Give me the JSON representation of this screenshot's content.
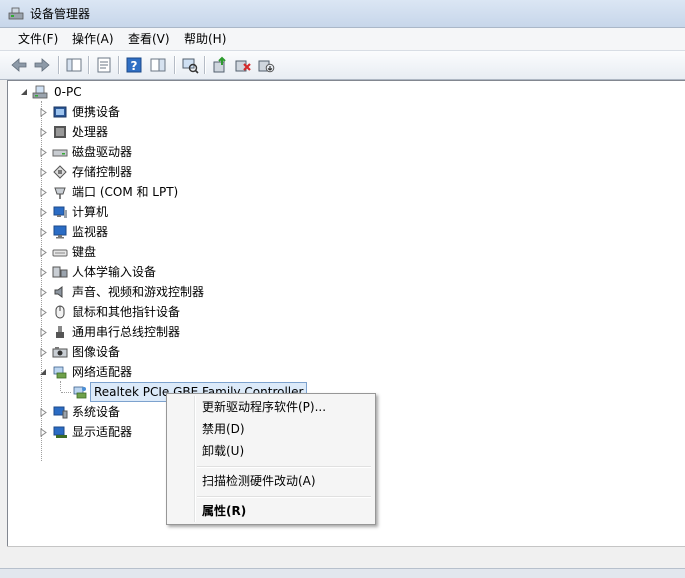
{
  "window": {
    "title": "设备管理器"
  },
  "menubar": {
    "items": [
      "文件(F)",
      "操作(A)",
      "查看(V)",
      "帮助(H)"
    ]
  },
  "toolbar": {
    "icons": [
      "back-arrow-icon",
      "forward-arrow-icon",
      "show-hide-tree-icon",
      "properties-icon",
      "help-icon",
      "action-pane-icon",
      "scan-hardware-icon",
      "update-driver-icon",
      "uninstall-icon",
      "disable-icon"
    ]
  },
  "tree": {
    "root": "0-PC",
    "categories": [
      {
        "label": "便携设备",
        "icon": "portable-device-icon"
      },
      {
        "label": "处理器",
        "icon": "processor-icon"
      },
      {
        "label": "磁盘驱动器",
        "icon": "disk-drive-icon"
      },
      {
        "label": "存储控制器",
        "icon": "storage-controller-icon"
      },
      {
        "label": "端口 (COM 和 LPT)",
        "icon": "port-icon"
      },
      {
        "label": "计算机",
        "icon": "computer-icon"
      },
      {
        "label": "监视器",
        "icon": "monitor-icon"
      },
      {
        "label": "键盘",
        "icon": "keyboard-icon"
      },
      {
        "label": "人体学输入设备",
        "icon": "hid-icon"
      },
      {
        "label": "声音、视频和游戏控制器",
        "icon": "sound-icon"
      },
      {
        "label": "鼠标和其他指针设备",
        "icon": "mouse-icon"
      },
      {
        "label": "通用串行总线控制器",
        "icon": "usb-icon"
      },
      {
        "label": "图像设备",
        "icon": "imaging-device-icon"
      },
      {
        "label": "网络适配器",
        "icon": "network-adapter-icon",
        "expanded": true
      },
      {
        "label": "系统设备",
        "icon": "system-device-icon"
      },
      {
        "label": "显示适配器",
        "icon": "display-adapter-icon"
      }
    ],
    "child": "Realtek PCIe GBE Family Controller"
  },
  "context_menu": {
    "update": "更新驱动程序软件(P)...",
    "disable": "禁用(D)",
    "uninstall": "卸载(U)",
    "scan": "扫描检测硬件改动(A)",
    "properties": "属性(R)"
  }
}
